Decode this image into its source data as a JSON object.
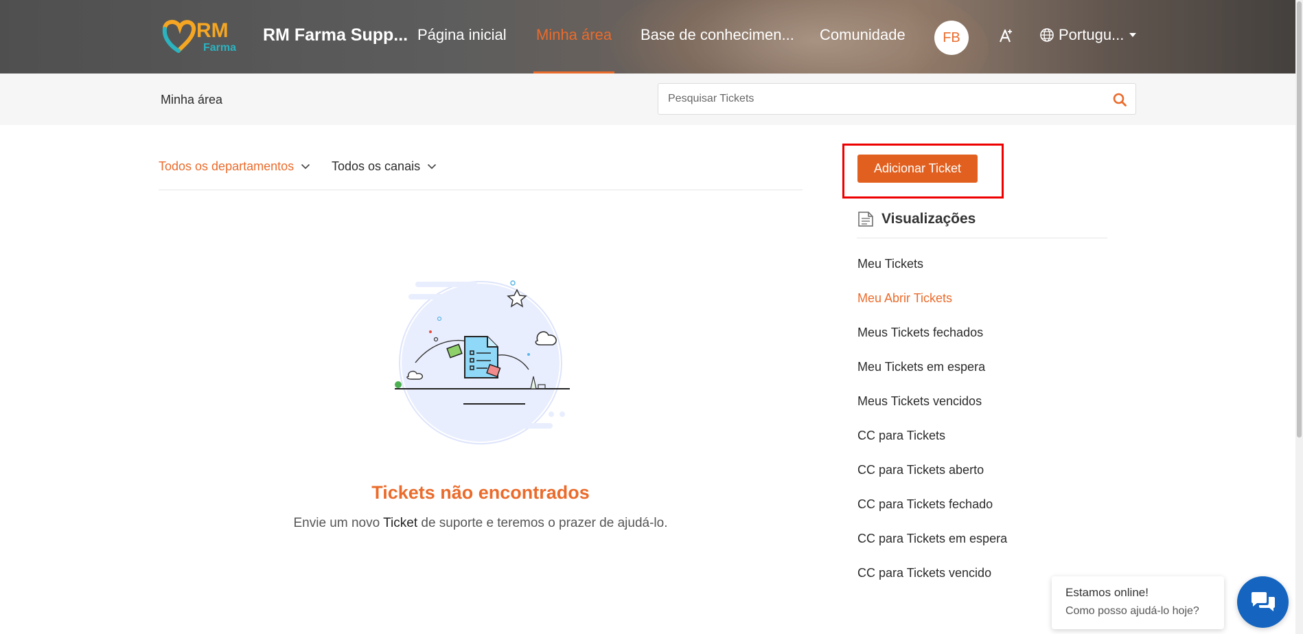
{
  "header": {
    "logo": {
      "text_top": "RM",
      "text_bottom": "Farma"
    },
    "brand": "RM Farma Supp...",
    "nav": [
      {
        "label": "Página inicial",
        "active": false
      },
      {
        "label": "Minha área",
        "active": true
      },
      {
        "label": "Base de conhecimen...",
        "active": false
      },
      {
        "label": "Comunidade",
        "active": false
      }
    ],
    "avatar_initials": "FB",
    "font_size_icon": "font-size-icon",
    "language": "Portugu..."
  },
  "subbar": {
    "breadcrumb": "Minha área",
    "search": {
      "placeholder": "Pesquisar Tickets",
      "value": ""
    }
  },
  "filters": {
    "department": "Todos os departamentos",
    "channel": "Todos os canais"
  },
  "empty_state": {
    "title": "Tickets não encontrados",
    "message_before": "Envie um novo ",
    "message_highlight": "Ticket",
    "message_after": " de suporte e teremos o prazer de ajudá-lo."
  },
  "sidebar": {
    "add_ticket": "Adicionar Ticket",
    "views_title": "Visualizações",
    "views": [
      {
        "label": "Meu Tickets",
        "active": false
      },
      {
        "label": "Meu Abrir Tickets",
        "active": true
      },
      {
        "label": "Meus Tickets fechados",
        "active": false
      },
      {
        "label": "Meu Tickets em espera",
        "active": false
      },
      {
        "label": "Meus Tickets vencidos",
        "active": false
      },
      {
        "label": "CC para Tickets",
        "active": false
      },
      {
        "label": "CC para Tickets aberto",
        "active": false
      },
      {
        "label": "CC para Tickets fechado",
        "active": false
      },
      {
        "label": "CC para Tickets em espera",
        "active": false
      },
      {
        "label": "CC para Tickets vencido",
        "active": false
      }
    ]
  },
  "chat": {
    "line1": "Estamos online!",
    "line2": "Como posso ajudá-lo hoje?"
  },
  "colors": {
    "accent": "#ea6b2b",
    "button": "#e2601f",
    "chat": "#1565c0",
    "highlight_box": "#ee0000"
  }
}
